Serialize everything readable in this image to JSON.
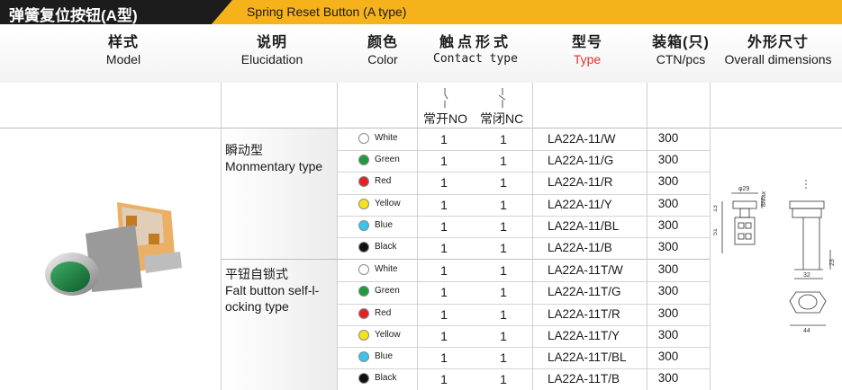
{
  "title": {
    "cn": "弹簧复位按钮(A型)",
    "en": "Spring Reset Button (A type)"
  },
  "columns": {
    "model": {
      "cn": "样式",
      "en": "Model"
    },
    "elucidation": {
      "cn": "说明",
      "en": "Elucidation"
    },
    "color": {
      "cn": "颜色",
      "en": "Color"
    },
    "contact": {
      "cn": "触点形式",
      "en": "Contact type",
      "no": "常开NO",
      "nc": "常闭NC"
    },
    "type": {
      "cn": "型号",
      "en": "Type"
    },
    "ctn": {
      "cn": "装箱(只)",
      "en": "CTN/pcs"
    },
    "dimensions": {
      "cn": "外形尺寸",
      "en": "Overall dimensions"
    }
  },
  "groups": [
    {
      "cn": "瞬动型",
      "en": "Monmentary type"
    },
    {
      "cn": "平钮自锁式",
      "en_lines": [
        "Falt button self-l-",
        "ocking type"
      ]
    }
  ],
  "rows": [
    {
      "color": "White",
      "dot": "#ffffff",
      "no": "1",
      "nc": "1",
      "type": "LA22A-11/W",
      "ctn": "300"
    },
    {
      "color": "Green",
      "dot": "#1f9a3c",
      "no": "1",
      "nc": "1",
      "type": "LA22A-11/G",
      "ctn": "300"
    },
    {
      "color": "Red",
      "dot": "#e02424",
      "no": "1",
      "nc": "1",
      "type": "LA22A-11/R",
      "ctn": "300"
    },
    {
      "color": "Yellow",
      "dot": "#f4e21a",
      "no": "1",
      "nc": "1",
      "type": "LA22A-11/Y",
      "ctn": "300"
    },
    {
      "color": "Blue",
      "dot": "#38c4ec",
      "no": "1",
      "nc": "1",
      "type": "LA22A-11/BL",
      "ctn": "300"
    },
    {
      "color": "Black",
      "dot": "#111111",
      "no": "1",
      "nc": "1",
      "type": "LA22A-11/B",
      "ctn": "300"
    },
    {
      "color": "White",
      "dot": "#ffffff",
      "no": "1",
      "nc": "1",
      "type": "LA22A-11T/W",
      "ctn": "300"
    },
    {
      "color": "Green",
      "dot": "#1f9a3c",
      "no": "1",
      "nc": "1",
      "type": "LA22A-11T/G",
      "ctn": "300"
    },
    {
      "color": "Red",
      "dot": "#e02424",
      "no": "1",
      "nc": "1",
      "type": "LA22A-11T/R",
      "ctn": "300"
    },
    {
      "color": "Yellow",
      "dot": "#f4e21a",
      "no": "1",
      "nc": "1",
      "type": "LA22A-11T/Y",
      "ctn": "300"
    },
    {
      "color": "Blue",
      "dot": "#38c4ec",
      "no": "1",
      "nc": "1",
      "type": "LA22A-11T/BL",
      "ctn": "300"
    },
    {
      "color": "Black",
      "dot": "#111111",
      "no": "1",
      "nc": "1",
      "type": "LA22A-11T/B",
      "ctn": "300"
    }
  ],
  "dimensions": {
    "d1": "φ29",
    "d2": "8Max",
    "d3": "13",
    "d4": "51",
    "d5": "23",
    "d6": "32",
    "d7": "44"
  },
  "colors": {
    "accent": "#f6b21b",
    "title_dark": "#1c1c1c",
    "type_red": "#e8322d"
  }
}
